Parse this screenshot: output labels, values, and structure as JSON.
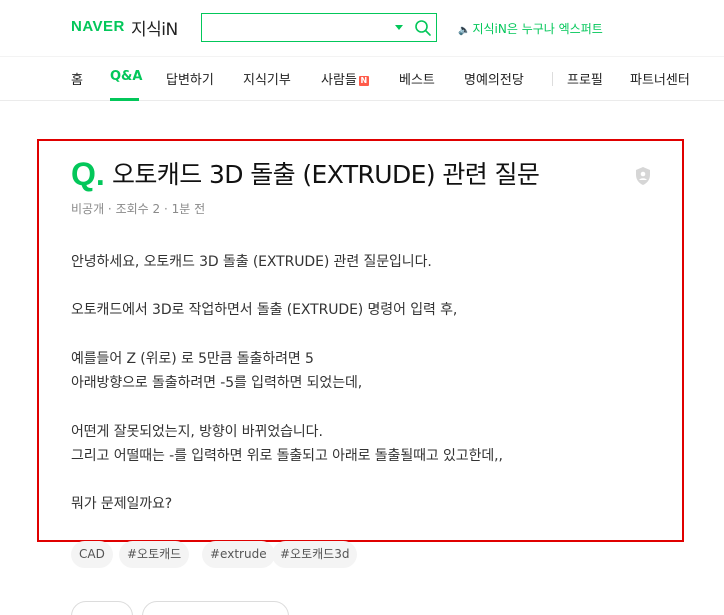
{
  "header": {
    "logo_naver": "NAVER",
    "logo_kin": "지식iN",
    "search": {
      "value": "",
      "placeholder": ""
    },
    "promo_text": "지식iN은 누구나 엑스퍼트",
    "colors": {
      "brand": "#03c75a",
      "highlight": "#e00000"
    }
  },
  "nav": {
    "items": [
      {
        "label": "홈"
      },
      {
        "label": "Q&A"
      },
      {
        "label": "답변하기"
      },
      {
        "label": "지식기부"
      },
      {
        "label": "사람들",
        "badge": "N"
      },
      {
        "label": "베스트"
      },
      {
        "label": "명예의전당"
      },
      {
        "label": "프로필"
      },
      {
        "label": "파트너센터"
      }
    ]
  },
  "question": {
    "mark": "Q.",
    "title": "오토캐드 3D 돌출 (EXTRUDE) 관련 질문",
    "meta": "비공개 · 조회수 2 · 1분 전",
    "body": [
      "안녕하세요, 오토캐드 3D  돌출 (EXTRUDE) 관련 질문입니다.",
      "오토캐드에서 3D로 작업하면서 돌출 (EXTRUDE) 명령어 입력 후,",
      "예를들어 Z (위로) 로 5만큼 돌출하려면 5",
      "아래방향으로 돌출하려면 -5를 입력하면 되었는데,",
      "어떤게 잘못되었는지, 방향이 바뀌었습니다.",
      "그리고 어떨때는 -를 입력하면 위로 돌출되고 아래로 돌출될때고 있고한데,,",
      "뭐가 문제일까요?"
    ]
  },
  "tags": [
    "CAD",
    "#오토캐드",
    "#extrude",
    "#오토캐드3d"
  ]
}
